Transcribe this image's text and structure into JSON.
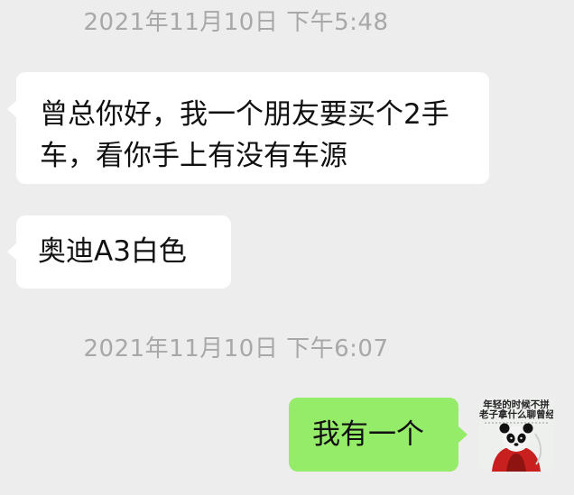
{
  "chat": {
    "messages": [
      {
        "timestamp": "2021年11月10日 下午5:48"
      },
      {
        "side": "incoming",
        "text": "曾总你好，我一个朋友要买个2手车，看你手上有没有车源"
      },
      {
        "side": "incoming",
        "text": "奥迪A3白色"
      },
      {
        "timestamp": "2021年11月10日 下午6:07"
      },
      {
        "side": "outgoing",
        "text": "我有一个"
      }
    ],
    "avatar": {
      "caption_line1": "年轻的时候不拼",
      "caption_line2": "老子拿什么聊曾经",
      "icon": "panda-avatar"
    }
  },
  "colors": {
    "background": "#ededed",
    "incoming_bubble": "#ffffff",
    "outgoing_bubble": "#95ec69",
    "timestamp_text": "#a8a8a8",
    "message_text": "#111111"
  }
}
